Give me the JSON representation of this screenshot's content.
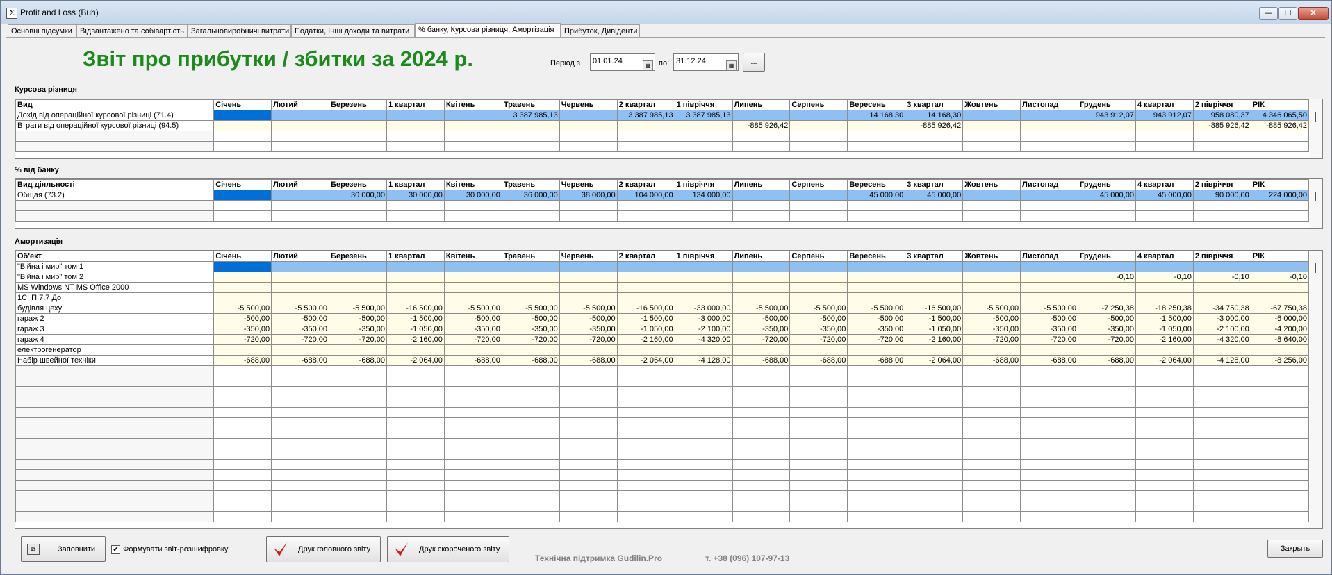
{
  "window": {
    "title": "Profit and Loss (Buh)",
    "icon": "sigma-icon"
  },
  "tabs": [
    {
      "label": "Основні підсумки"
    },
    {
      "label": "Відвантажено та собівартість"
    },
    {
      "label": "Загальновиробничі витрати"
    },
    {
      "label": "Податки, Інші доходи та витрати"
    },
    {
      "label": "% банку, Курсова різниця, Амортізація",
      "active": true
    },
    {
      "label": "Прибуток, Дивіденти"
    }
  ],
  "report": {
    "title": "Звіт про прибутки / збитки за 2024 р."
  },
  "period": {
    "label_from": "Період з",
    "from": "01.01.24",
    "label_to": "по:",
    "to": "31.12.24",
    "more_button": "..."
  },
  "months": [
    "Січень",
    "Лютий",
    "Березень",
    "1 квартал",
    "Квітень",
    "Травень",
    "Червень",
    "2 квартал",
    "1 півріччя",
    "Липень",
    "Серпень",
    "Вересень",
    "3 квартал",
    "Жовтень",
    "Листопад",
    "Грудень",
    "4 квартал",
    "2 півріччя",
    "РІК"
  ],
  "sections": {
    "exchange": {
      "title": "Курсова різниця",
      "first_col": "Вид",
      "rows": [
        {
          "name": "Дохід від операційної курсової різниці (71.4)",
          "values": [
            "",
            "",
            "",
            "",
            "",
            "3 387 985,13",
            "",
            "3 387 985,13",
            "3 387 985,13",
            "",
            "",
            "14 168,30",
            "14 168,30",
            "",
            "",
            "943 912,07",
            "943 912,07",
            "958 080,37",
            "4 346 065,50"
          ]
        },
        {
          "name": "Втрати від операційної курсової різниці (94.5)",
          "values": [
            "",
            "",
            "",
            "",
            "",
            "",
            "",
            "",
            "",
            "-885 926,42",
            "",
            "",
            "-885 926,42",
            "",
            "",
            "",
            "",
            "-885 926,42",
            "-885 926,42"
          ]
        }
      ]
    },
    "bank": {
      "title": "% від банку",
      "first_col": "Вид діяльності",
      "rows": [
        {
          "name": "Общая (73.2)",
          "values": [
            "",
            "",
            "30 000,00",
            "30 000,00",
            "30 000,00",
            "36 000,00",
            "38 000,00",
            "104 000,00",
            "134 000,00",
            "",
            "",
            "45 000,00",
            "45 000,00",
            "",
            "",
            "45 000,00",
            "45 000,00",
            "90 000,00",
            "224 000,00"
          ]
        }
      ]
    },
    "amortization": {
      "title": "Амортизація",
      "first_col": "Об'ект",
      "rows": [
        {
          "name": "\"Війна і мир\" том 1",
          "values": [
            "",
            "",
            "",
            "",
            "",
            "",
            "",
            "",
            "",
            "",
            "",
            "",
            "",
            "",
            "",
            "",
            "",
            "",
            ""
          ]
        },
        {
          "name": "\"Війна і мир\" том 2",
          "values": [
            "",
            "",
            "",
            "",
            "",
            "",
            "",
            "",
            "",
            "",
            "",
            "",
            "",
            "",
            "",
            "-0,10",
            "-0,10",
            "-0,10",
            "-0,10"
          ]
        },
        {
          "name": "MS Windows NT MS Office 2000",
          "values": [
            "",
            "",
            "",
            "",
            "",
            "",
            "",
            "",
            "",
            "",
            "",
            "",
            "",
            "",
            "",
            "",
            "",
            "",
            ""
          ]
        },
        {
          "name": "1С: П 7.7 До",
          "values": [
            "",
            "",
            "",
            "",
            "",
            "",
            "",
            "",
            "",
            "",
            "",
            "",
            "",
            "",
            "",
            "",
            "",
            "",
            ""
          ]
        },
        {
          "name": "будівля цеху",
          "values": [
            "-5 500,00",
            "-5 500,00",
            "-5 500,00",
            "-16 500,00",
            "-5 500,00",
            "-5 500,00",
            "-5 500,00",
            "-16 500,00",
            "-33 000,00",
            "-5 500,00",
            "-5 500,00",
            "-5 500,00",
            "-16 500,00",
            "-5 500,00",
            "-5 500,00",
            "-7 250,38",
            "-18 250,38",
            "-34 750,38",
            "-67 750,38"
          ]
        },
        {
          "name": "гараж 2",
          "values": [
            "-500,00",
            "-500,00",
            "-500,00",
            "-1 500,00",
            "-500,00",
            "-500,00",
            "-500,00",
            "-1 500,00",
            "-3 000,00",
            "-500,00",
            "-500,00",
            "-500,00",
            "-1 500,00",
            "-500,00",
            "-500,00",
            "-500,00",
            "-1 500,00",
            "-3 000,00",
            "-6 000,00"
          ]
        },
        {
          "name": "гараж 3",
          "values": [
            "-350,00",
            "-350,00",
            "-350,00",
            "-1 050,00",
            "-350,00",
            "-350,00",
            "-350,00",
            "-1 050,00",
            "-2 100,00",
            "-350,00",
            "-350,00",
            "-350,00",
            "-1 050,00",
            "-350,00",
            "-350,00",
            "-350,00",
            "-1 050,00",
            "-2 100,00",
            "-4 200,00"
          ]
        },
        {
          "name": "гараж 4",
          "values": [
            "-720,00",
            "-720,00",
            "-720,00",
            "-2 160,00",
            "-720,00",
            "-720,00",
            "-720,00",
            "-2 160,00",
            "-4 320,00",
            "-720,00",
            "-720,00",
            "-720,00",
            "-2 160,00",
            "-720,00",
            "-720,00",
            "-720,00",
            "-2 160,00",
            "-4 320,00",
            "-8 640,00"
          ]
        },
        {
          "name": "електрогенератор",
          "values": [
            "",
            "",
            "",
            "",
            "",
            "",
            "",
            "",
            "",
            "",
            "",
            "",
            "",
            "",
            "",
            "",
            "",
            "",
            ""
          ]
        },
        {
          "name": "Набір швейної техніки",
          "values": [
            "-688,00",
            "-688,00",
            "-688,00",
            "-2 064,00",
            "-688,00",
            "-688,00",
            "-688,00",
            "-2 064,00",
            "-4 128,00",
            "-688,00",
            "-688,00",
            "-688,00",
            "-2 064,00",
            "-688,00",
            "-688,00",
            "-688,00",
            "-2 064,00",
            "-4 128,00",
            "-8 256,00"
          ]
        }
      ]
    }
  },
  "bottom": {
    "fill_button": "Заповнити",
    "detail_checkbox": {
      "label": "Формувати звіт-розшифровку",
      "checked": true
    },
    "print_main": "Друк головного звіту",
    "print_short": "Друк скороченого звіту",
    "support": "Технічна підтримка Gudilin.Pro",
    "phone": "т. +38 (096) 107-97-13",
    "close_button": "Закрыть"
  },
  "colors": {
    "title_green": "#1a8a1a",
    "selected_row": "#8ec0f2",
    "selected_cell": "#0070d8",
    "data_row": "#fffce8"
  }
}
